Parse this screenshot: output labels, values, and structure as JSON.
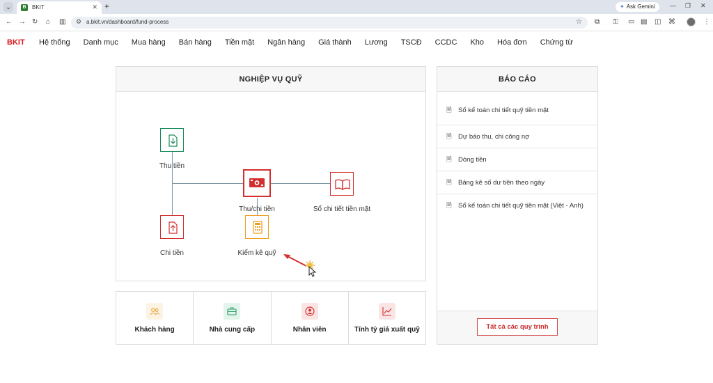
{
  "browser": {
    "tab_title": "BKIT",
    "tab_favicon": "B",
    "url": "a.bkit.vn/dashboard/fund-process",
    "ask_gemini": "Ask Gemini"
  },
  "app": {
    "brand": "BKIT",
    "brand_color": "#d71920",
    "menu": [
      "Hệ thống",
      "Danh mục",
      "Mua hàng",
      "Bán hàng",
      "Tiền mặt",
      "Ngân hàng",
      "Giá thành",
      "Lương",
      "TSCĐ",
      "CCDC",
      "Kho",
      "Hóa đơn",
      "Chứng từ"
    ]
  },
  "fund_process": {
    "title": "NGHIỆP VỤ QUỸ",
    "nodes": {
      "thu_tien": {
        "label": "Thu tiền",
        "icon": "download-doc-icon",
        "color": "#1a8a5a"
      },
      "thu_chi_tien": {
        "label": "Thu/chi tiền",
        "icon": "cash-icon",
        "color": "#d32f2f"
      },
      "so_chi_tiet": {
        "label": "Sổ chi tiết tiền mặt",
        "icon": "book-icon",
        "color": "#d32f2f"
      },
      "chi_tien": {
        "label": "Chi tiền",
        "icon": "upload-doc-icon",
        "color": "#d32f2f"
      },
      "kiem_ke_quy": {
        "label": "Kiểm kê quỹ",
        "icon": "calculator-icon",
        "color": "#f0a020"
      }
    }
  },
  "shortcuts": [
    {
      "label": "Khách hàng",
      "icon": "users-icon",
      "color": "#e8a33a",
      "bg": "#fdf3e3"
    },
    {
      "label": "Nhà cung cấp",
      "icon": "briefcase-icon",
      "color": "#2e9c6a",
      "bg": "#e3f4ec"
    },
    {
      "label": "Nhân viên",
      "icon": "user-circle-icon",
      "color": "#d32f2f",
      "bg": "#fbe4e4"
    },
    {
      "label": "Tính tỷ giá xuất quỹ",
      "icon": "chart-line-icon",
      "color": "#d32f2f",
      "bg": "#fbe4e4"
    }
  ],
  "report": {
    "title": "BÁO CÁO",
    "items": [
      "Sổ kế toán chi tiết quỹ tiền mặt",
      "Dự báo thu, chi công nợ",
      "Dòng tiền",
      "Bảng kê số dư tiền theo ngày",
      "Sổ kế toán chi tiết quỹ tiền mặt (Việt - Anh)"
    ],
    "all_button": "Tất cả các quy trình"
  }
}
